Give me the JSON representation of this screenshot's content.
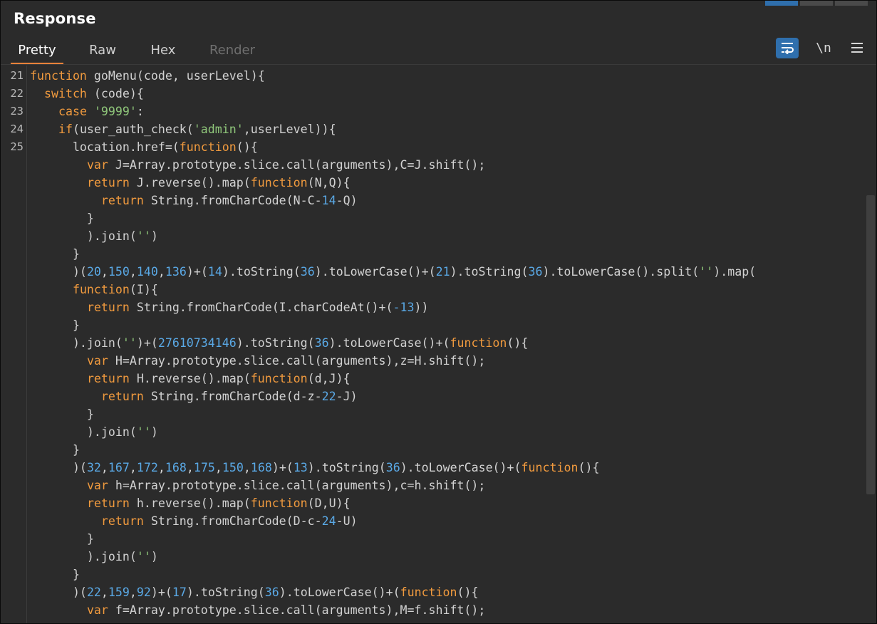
{
  "panel": {
    "title": "Response",
    "tabs": [
      {
        "label": "Pretty",
        "state": "active"
      },
      {
        "label": "Raw",
        "state": "normal"
      },
      {
        "label": "Hex",
        "state": "normal"
      },
      {
        "label": "Render",
        "state": "disabled"
      }
    ],
    "toolbar": {
      "wrap_icon": "wrap-lines-icon",
      "newline_label": "\\n",
      "menu_icon": "hamburger-menu-icon"
    },
    "colors": {
      "accent_tab": "#e8823a",
      "active_button": "#2f6fad",
      "keyword": "#f09a3e",
      "string": "#8fc67a",
      "number": "#5aa9e6"
    }
  },
  "editor": {
    "line_numbers": [
      "21",
      "22",
      "23",
      "24",
      "25"
    ],
    "lines": [
      [
        [
          "kw",
          "function"
        ],
        [
          "t",
          " goMenu(code, userLevel){"
        ]
      ],
      [
        [
          "t",
          "  "
        ],
        [
          "kw",
          "switch"
        ],
        [
          "t",
          " (code){"
        ]
      ],
      [
        [
          "t",
          "    "
        ],
        [
          "kw",
          "case"
        ],
        [
          "t",
          " "
        ],
        [
          "str",
          "'9999'"
        ],
        [
          "t",
          ":"
        ]
      ],
      [
        [
          "t",
          "    "
        ],
        [
          "kw",
          "if"
        ],
        [
          "t",
          "(user_auth_check("
        ],
        [
          "str",
          "'admin'"
        ],
        [
          "t",
          ",userLevel)){"
        ]
      ],
      [
        [
          "t",
          "      location.href=("
        ],
        [
          "kw",
          "function"
        ],
        [
          "t",
          "(){"
        ]
      ],
      [
        [
          "t",
          "        "
        ],
        [
          "kw",
          "var"
        ],
        [
          "t",
          " J=Array.prototype.slice.call(arguments),C=J.shift();"
        ]
      ],
      [
        [
          "t",
          "        "
        ],
        [
          "kw",
          "return"
        ],
        [
          "t",
          " J.reverse().map("
        ],
        [
          "kw",
          "function"
        ],
        [
          "t",
          "(N,Q){"
        ]
      ],
      [
        [
          "t",
          "          "
        ],
        [
          "kw",
          "return"
        ],
        [
          "t",
          " String.fromCharCode(N-C-"
        ],
        [
          "num",
          "14"
        ],
        [
          "t",
          "-Q)"
        ]
      ],
      [
        [
          "t",
          "        }"
        ]
      ],
      [
        [
          "t",
          "        ).join("
        ],
        [
          "str",
          "''"
        ],
        [
          "t",
          ")"
        ]
      ],
      [
        [
          "t",
          "      }"
        ]
      ],
      [
        [
          "t",
          "      )("
        ],
        [
          "num",
          "20"
        ],
        [
          "t",
          ","
        ],
        [
          "num",
          "150"
        ],
        [
          "t",
          ","
        ],
        [
          "num",
          "140"
        ],
        [
          "t",
          ","
        ],
        [
          "num",
          "136"
        ],
        [
          "t",
          ")+("
        ],
        [
          "num",
          "14"
        ],
        [
          "t",
          ").toString("
        ],
        [
          "num",
          "36"
        ],
        [
          "t",
          ").toLowerCase()+("
        ],
        [
          "num",
          "21"
        ],
        [
          "t",
          ").toString("
        ],
        [
          "num",
          "36"
        ],
        [
          "t",
          ").toLowerCase().split("
        ],
        [
          "str",
          "''"
        ],
        [
          "t",
          ").map("
        ]
      ],
      [
        [
          "t",
          "      "
        ],
        [
          "kw",
          "function"
        ],
        [
          "t",
          "(I){"
        ]
      ],
      [
        [
          "t",
          "        "
        ],
        [
          "kw",
          "return"
        ],
        [
          "t",
          " String.fromCharCode(I.charCodeAt()+("
        ],
        [
          "num",
          "-13"
        ],
        [
          "t",
          "))"
        ]
      ],
      [
        [
          "t",
          "      }"
        ]
      ],
      [
        [
          "t",
          "      ).join("
        ],
        [
          "str",
          "''"
        ],
        [
          "t",
          ")+("
        ],
        [
          "num",
          "27610734146"
        ],
        [
          "t",
          ").toString("
        ],
        [
          "num",
          "36"
        ],
        [
          "t",
          ").toLowerCase()+("
        ],
        [
          "kw",
          "function"
        ],
        [
          "t",
          "(){"
        ]
      ],
      [
        [
          "t",
          "        "
        ],
        [
          "kw",
          "var"
        ],
        [
          "t",
          " H=Array.prototype.slice.call(arguments),z=H.shift();"
        ]
      ],
      [
        [
          "t",
          "        "
        ],
        [
          "kw",
          "return"
        ],
        [
          "t",
          " H.reverse().map("
        ],
        [
          "kw",
          "function"
        ],
        [
          "t",
          "(d,J){"
        ]
      ],
      [
        [
          "t",
          "          "
        ],
        [
          "kw",
          "return"
        ],
        [
          "t",
          " String.fromCharCode(d-z-"
        ],
        [
          "num",
          "22"
        ],
        [
          "t",
          "-J)"
        ]
      ],
      [
        [
          "t",
          "        }"
        ]
      ],
      [
        [
          "t",
          "        ).join("
        ],
        [
          "str",
          "''"
        ],
        [
          "t",
          ")"
        ]
      ],
      [
        [
          "t",
          "      }"
        ]
      ],
      [
        [
          "t",
          "      )("
        ],
        [
          "num",
          "32"
        ],
        [
          "t",
          ","
        ],
        [
          "num",
          "167"
        ],
        [
          "t",
          ","
        ],
        [
          "num",
          "172"
        ],
        [
          "t",
          ","
        ],
        [
          "num",
          "168"
        ],
        [
          "t",
          ","
        ],
        [
          "num",
          "175"
        ],
        [
          "t",
          ","
        ],
        [
          "num",
          "150"
        ],
        [
          "t",
          ","
        ],
        [
          "num",
          "168"
        ],
        [
          "t",
          ")+("
        ],
        [
          "num",
          "13"
        ],
        [
          "t",
          ").toString("
        ],
        [
          "num",
          "36"
        ],
        [
          "t",
          ").toLowerCase()+("
        ],
        [
          "kw",
          "function"
        ],
        [
          "t",
          "(){"
        ]
      ],
      [
        [
          "t",
          "        "
        ],
        [
          "kw",
          "var"
        ],
        [
          "t",
          " h=Array.prototype.slice.call(arguments),c=h.shift();"
        ]
      ],
      [
        [
          "t",
          "        "
        ],
        [
          "kw",
          "return"
        ],
        [
          "t",
          " h.reverse().map("
        ],
        [
          "kw",
          "function"
        ],
        [
          "t",
          "(D,U){"
        ]
      ],
      [
        [
          "t",
          "          "
        ],
        [
          "kw",
          "return"
        ],
        [
          "t",
          " String.fromCharCode(D-c-"
        ],
        [
          "num",
          "24"
        ],
        [
          "t",
          "-U)"
        ]
      ],
      [
        [
          "t",
          "        }"
        ]
      ],
      [
        [
          "t",
          "        ).join("
        ],
        [
          "str",
          "''"
        ],
        [
          "t",
          ")"
        ]
      ],
      [
        [
          "t",
          "      }"
        ]
      ],
      [
        [
          "t",
          "      )("
        ],
        [
          "num",
          "22"
        ],
        [
          "t",
          ","
        ],
        [
          "num",
          "159"
        ],
        [
          "t",
          ","
        ],
        [
          "num",
          "92"
        ],
        [
          "t",
          ")+("
        ],
        [
          "num",
          "17"
        ],
        [
          "t",
          ").toString("
        ],
        [
          "num",
          "36"
        ],
        [
          "t",
          ").toLowerCase()+("
        ],
        [
          "kw",
          "function"
        ],
        [
          "t",
          "(){"
        ]
      ],
      [
        [
          "t",
          "        "
        ],
        [
          "kw",
          "var"
        ],
        [
          "t",
          " f=Array.prototype.slice.call(arguments),M=f.shift();"
        ]
      ]
    ]
  }
}
